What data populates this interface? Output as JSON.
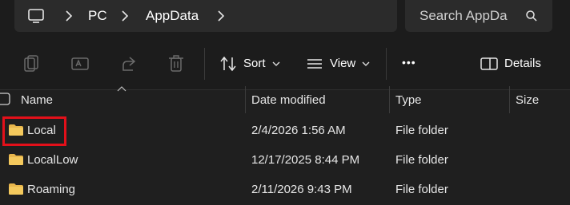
{
  "breadcrumb": {
    "items": [
      "PC",
      "AppData"
    ]
  },
  "search": {
    "placeholder": "Search AppDa"
  },
  "toolbar": {
    "sort_label": "Sort",
    "view_label": "View",
    "more_label": "•••",
    "details_label": "Details"
  },
  "columns": {
    "name": "Name",
    "date_modified": "Date modified",
    "type": "Type",
    "size": "Size"
  },
  "rows": [
    {
      "name": "Local",
      "date": "2/4/2026 1:56 AM",
      "type": "File folder"
    },
    {
      "name": "LocalLow",
      "date": "12/17/2025 8:44 PM",
      "type": "File folder"
    },
    {
      "name": "Roaming",
      "date": "2/11/2026 9:43 PM",
      "type": "File folder"
    }
  ],
  "colors": {
    "folder": "#e8b64c",
    "highlight_border": "#e3101a",
    "background": "#1f1f1f"
  }
}
